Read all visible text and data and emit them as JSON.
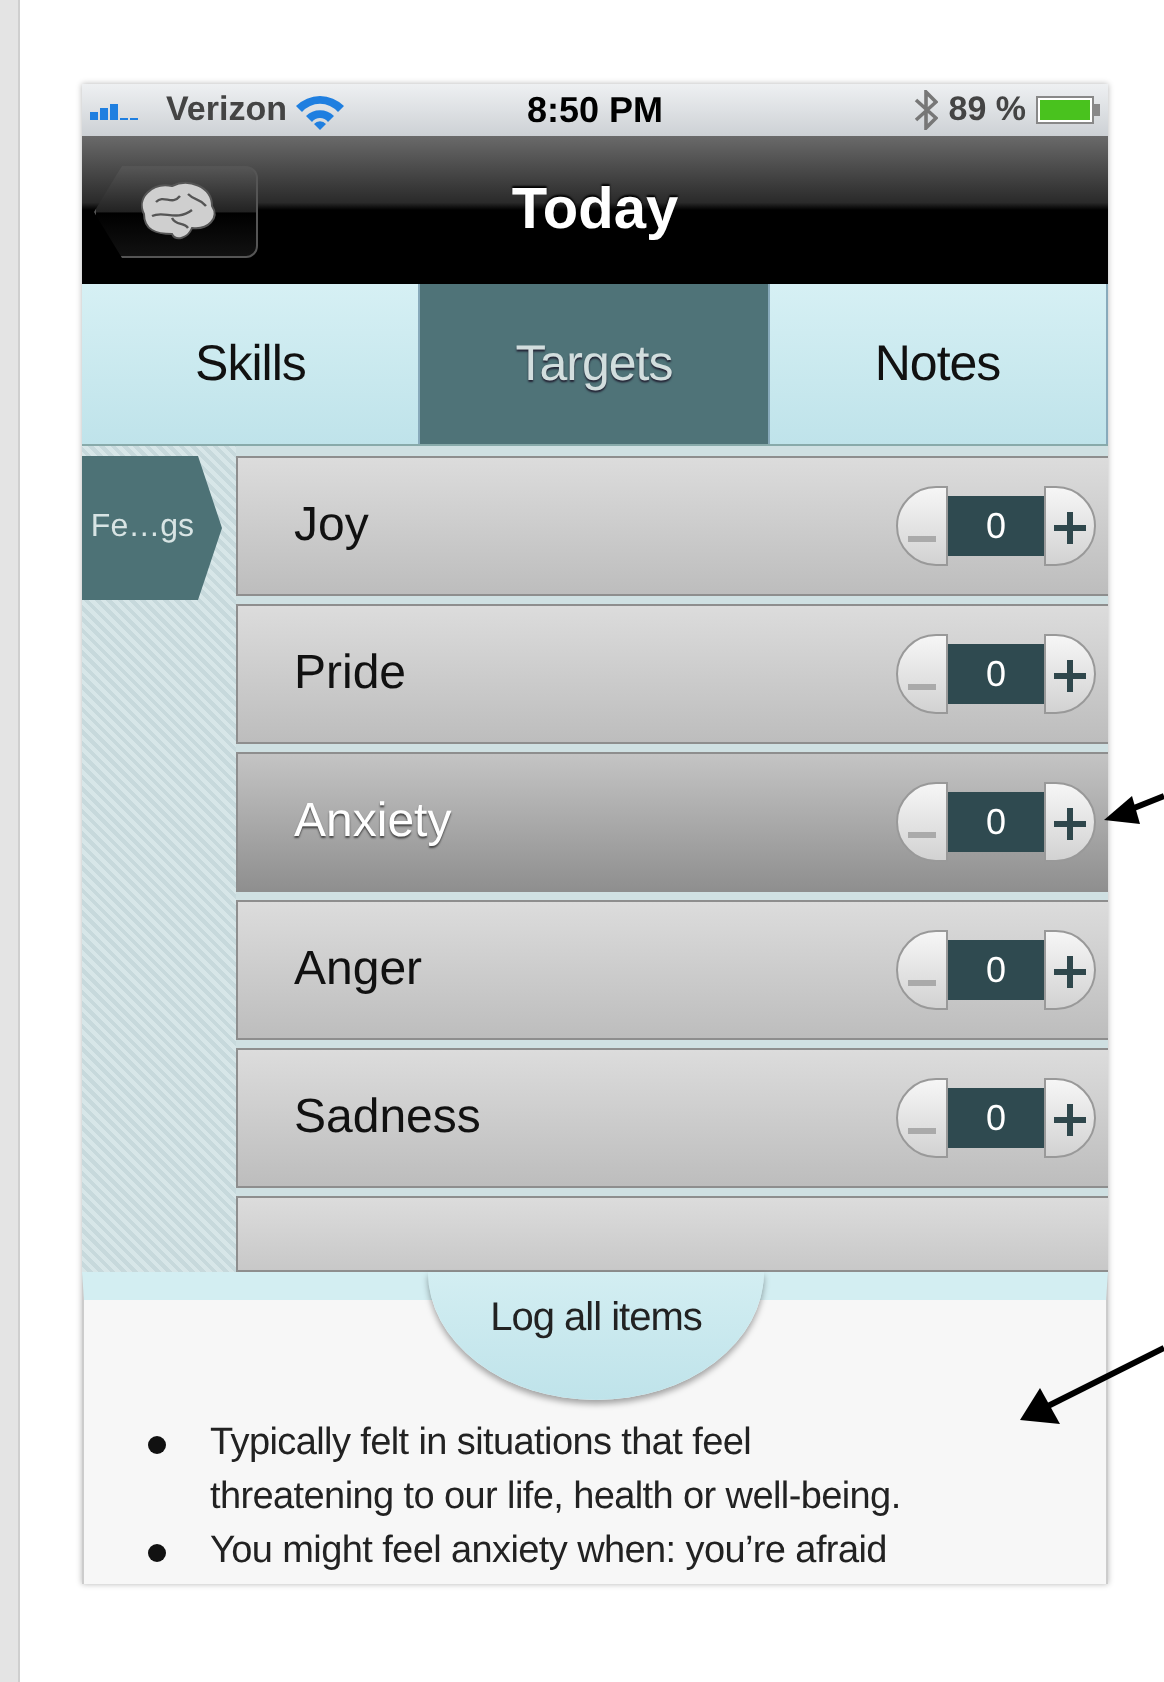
{
  "status_bar": {
    "carrier": "Verizon",
    "time": "8:50 PM",
    "battery": "89 %"
  },
  "nav_bar": {
    "title": "Today"
  },
  "tabs": [
    {
      "label": "Skills",
      "selected": false
    },
    {
      "label": "Targets",
      "selected": true
    },
    {
      "label": "Notes",
      "selected": false
    }
  ],
  "breadcrumb": "Fe…gs",
  "rows": [
    {
      "name": "Joy",
      "value": "0",
      "selected": false
    },
    {
      "name": "Pride",
      "value": "0",
      "selected": false
    },
    {
      "name": "Anxiety",
      "value": "0",
      "selected": true
    },
    {
      "name": "Anger",
      "value": "0",
      "selected": false
    },
    {
      "name": "Sadness",
      "value": "0",
      "selected": false
    }
  ],
  "sheet": {
    "button": "Log all items",
    "bullets": [
      "Typically felt in situations that feel threatening to our life, health or well-being.",
      "You might feel anxiety when: you’re afraid"
    ]
  }
}
